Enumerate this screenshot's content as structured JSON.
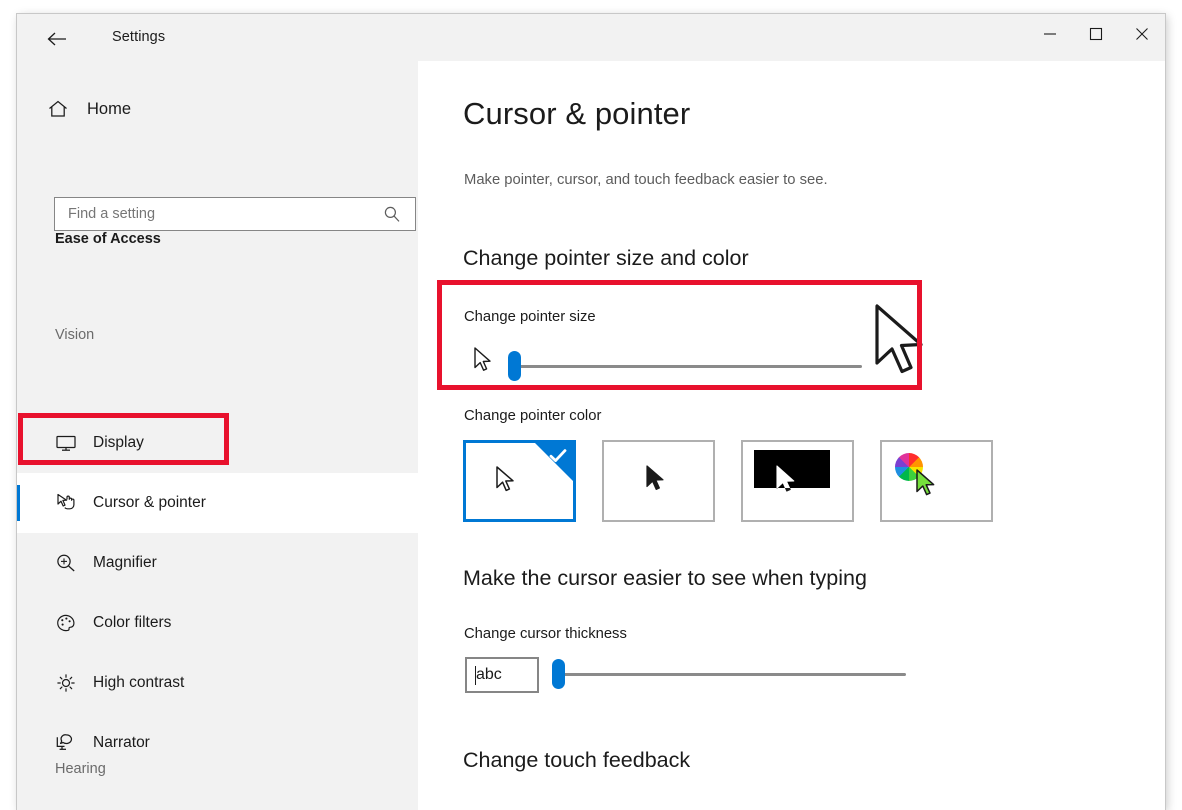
{
  "window": {
    "app_title": "Settings",
    "back_icon": "back-arrow-icon",
    "minimize_label": "—",
    "maximize_label": "□",
    "close_label": "✕"
  },
  "sidebar": {
    "home_label": "Home",
    "home_icon": "home-icon",
    "search": {
      "placeholder": "Find a setting",
      "value": "",
      "icon": "search-icon"
    },
    "category": "Ease of Access",
    "section_vision": "Vision",
    "section_hearing": "Hearing",
    "items": [
      {
        "label": "Display",
        "icon": "monitor-icon",
        "selected": false
      },
      {
        "label": "Cursor & pointer",
        "icon": "cursor-hand-icon",
        "selected": true
      },
      {
        "label": "Magnifier",
        "icon": "magnifier-plus-icon",
        "selected": false
      },
      {
        "label": "Color filters",
        "icon": "palette-icon",
        "selected": false
      },
      {
        "label": "High contrast",
        "icon": "sun-icon",
        "selected": false
      },
      {
        "label": "Narrator",
        "icon": "narrator-speech-icon",
        "selected": false
      }
    ]
  },
  "main": {
    "title": "Cursor & pointer",
    "subtitle": "Make pointer, cursor, and touch feedback easier to see.",
    "section_pointer": "Change pointer size and color",
    "pointer_size": {
      "label": "Change pointer size",
      "small_icon": "small-cursor-icon",
      "large_icon": "large-cursor-icon",
      "value_percent": 0
    },
    "pointer_color": {
      "label": "Change pointer color",
      "options": [
        {
          "name": "white-pointer",
          "selected": true
        },
        {
          "name": "black-pointer",
          "selected": false
        },
        {
          "name": "inverted-pointer",
          "selected": false
        },
        {
          "name": "custom-color-pointer",
          "selected": false
        }
      ]
    },
    "section_typing": "Make the cursor easier to see when typing",
    "cursor_thickness": {
      "label": "Change cursor thickness",
      "preview_text": "abc",
      "value_percent": 0
    },
    "section_touch": "Change touch feedback"
  },
  "annotations": {
    "highlight_color": "#e8112d",
    "boxes": [
      "pointer-size-highlight",
      "cursor-pointer-nav-highlight"
    ]
  },
  "colors": {
    "accent": "#0078d4",
    "window_bg": "#f2f2f2",
    "content_bg": "#ffffff",
    "text": "#1b1b1b",
    "muted_text": "#6b6b6b"
  }
}
